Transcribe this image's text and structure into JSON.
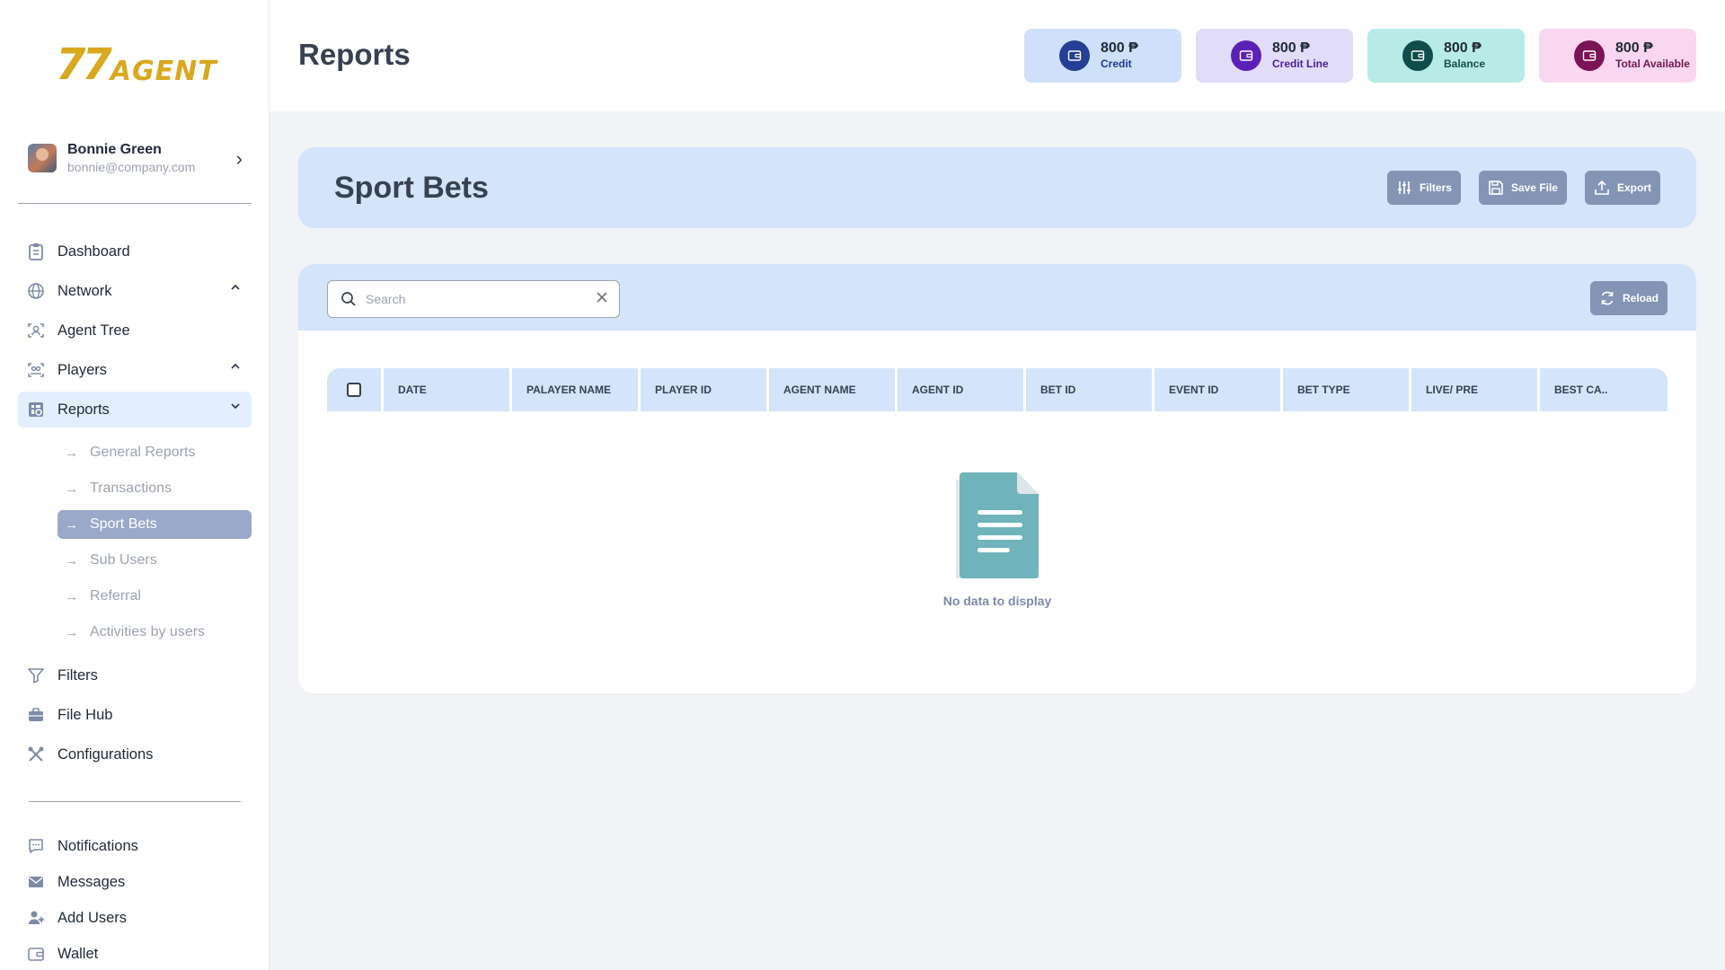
{
  "brand": {
    "logo_mark": "77",
    "logo_text": "AGENT",
    "color": "#d9a81f"
  },
  "profile": {
    "name": "Bonnie Green",
    "email": "bonnie@company.com"
  },
  "nav": {
    "main": [
      {
        "label": "Dashboard",
        "icon": "clipboard-icon"
      },
      {
        "label": "Network",
        "icon": "globe-icon",
        "chevron": "up"
      },
      {
        "label": "Agent Tree",
        "icon": "user-scan-icon"
      },
      {
        "label": "Players",
        "icon": "users-scan-icon",
        "chevron": "up"
      },
      {
        "label": "Reports",
        "icon": "report-icon",
        "chevron": "down",
        "active": true
      }
    ],
    "reports_sub": [
      {
        "label": "General Reports"
      },
      {
        "label": "Transactions"
      },
      {
        "label": "Sport Bets",
        "active": true
      },
      {
        "label": "Sub Users"
      },
      {
        "label": "Referral"
      },
      {
        "label": "Activities by users"
      }
    ],
    "lower": [
      {
        "label": "Filters",
        "icon": "filter-icon"
      },
      {
        "label": "File Hub",
        "icon": "briefcase-icon"
      },
      {
        "label": "Configurations",
        "icon": "tools-icon"
      }
    ],
    "bottom": [
      {
        "label": "Notifications",
        "icon": "chat-icon"
      },
      {
        "label": "Messages",
        "icon": "mail-icon"
      },
      {
        "label": "Add Users",
        "icon": "user-add-icon"
      },
      {
        "label": "Wallet",
        "icon": "wallet-icon"
      }
    ]
  },
  "header": {
    "title": "Reports",
    "cards": [
      {
        "amount": "800 ₱",
        "label": "Credit",
        "bg": "#cfe0fb",
        "icon_bg": "#233f96",
        "label_color": "#1e3a8a"
      },
      {
        "amount": "800 ₱",
        "label": "Credit Line",
        "bg": "#e2dcfb",
        "icon_bg": "#5b21b6",
        "label_color": "#4c1d95"
      },
      {
        "amount": "800 ₱",
        "label": "Balance",
        "bg": "#b8ebe7",
        "icon_bg": "#0f4c4c",
        "label_color": "#134e4a"
      },
      {
        "amount": "800 ₱",
        "label": "Total Available",
        "bg": "#fbd6f1",
        "icon_bg": "#7a1456",
        "label_color": "#701a4f"
      }
    ]
  },
  "panel": {
    "title": "Sport Bets",
    "actions": {
      "filters": "Filters",
      "save_file": "Save File",
      "export": "Export"
    }
  },
  "table": {
    "search_placeholder": "Search",
    "reload_label": "Reload",
    "columns": [
      "DATE",
      "PALAYER NAME",
      "PLAYER ID",
      "AGENT NAME",
      "AGENT ID",
      "BET ID",
      "EVENT ID",
      "BET TYPE",
      "LIVE/ PRE",
      "BEST CA.."
    ],
    "rows": [],
    "empty_label": "No data to display"
  }
}
